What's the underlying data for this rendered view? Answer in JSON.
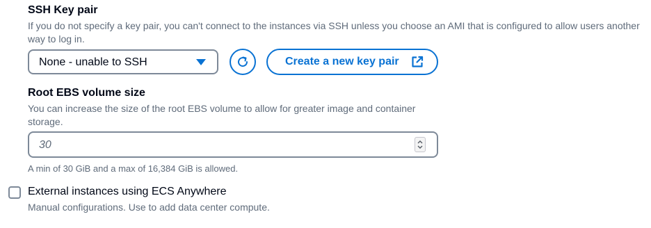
{
  "ssh_key_pair": {
    "title": "SSH Key pair",
    "description": "If you do not specify a key pair, you can't connect to the instances via SSH unless you choose an AMI that is configured to allow users another way to log in.",
    "selected_value": "None - unable to SSH",
    "refresh_icon": "refresh-icon",
    "create_button_label": "Create a new key pair",
    "create_button_icon": "external-link-icon"
  },
  "root_ebs": {
    "title": "Root EBS volume size",
    "description": "You can increase the size of the root EBS volume to allow for greater image and container storage.",
    "value": "30",
    "hint": "A min of 30 GiB and a max of 16,384 GiB is allowed."
  },
  "external_instances": {
    "checked": false,
    "label": "External instances using ECS Anywhere",
    "description": "Manual configurations. Use to add data center compute."
  },
  "colors": {
    "accent": "#0972d3",
    "border": "#7d8998",
    "text": "#000716",
    "secondary_text": "#5f6b7a"
  }
}
